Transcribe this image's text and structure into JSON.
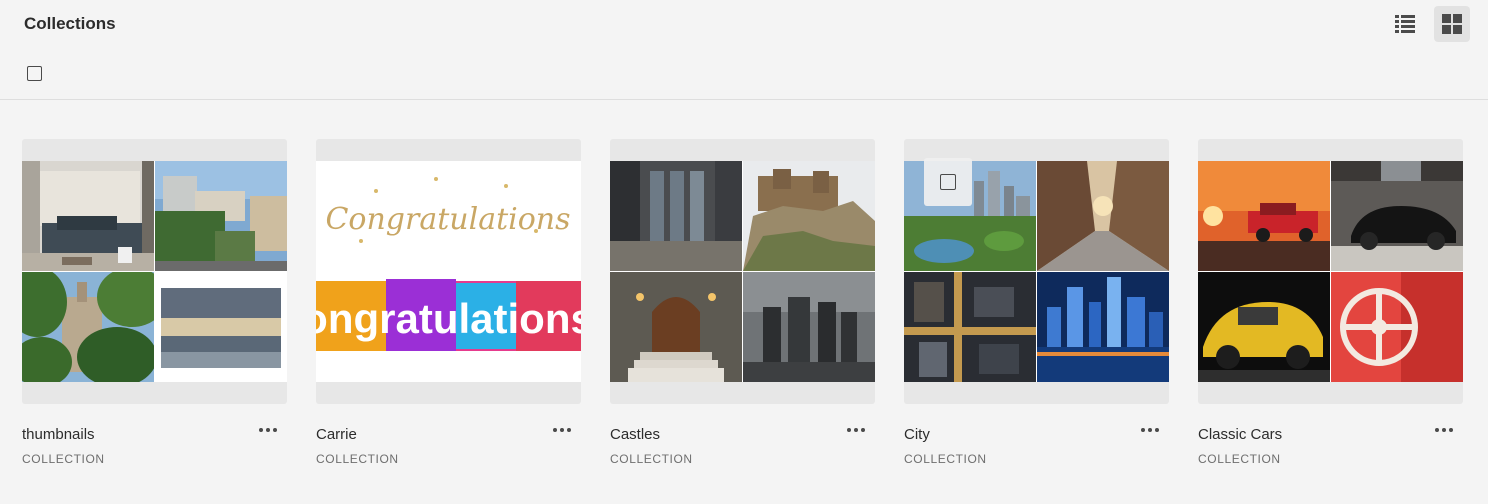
{
  "header": {
    "title": "Collections",
    "list_view_icon": "list-view-icon",
    "grid_view_icon": "grid-view-icon",
    "active_view": "grid"
  },
  "collections": [
    {
      "name": "thumbnails",
      "type": "COLLECTION"
    },
    {
      "name": "Carrie",
      "type": "COLLECTION"
    },
    {
      "name": "Castles",
      "type": "COLLECTION"
    },
    {
      "name": "City",
      "type": "COLLECTION"
    },
    {
      "name": "Classic Cars",
      "type": "COLLECTION"
    }
  ],
  "colors": {
    "background": "#f4f4f4",
    "card_frame": "#e7e7e7",
    "text_primary": "#2c2c2c",
    "text_secondary": "#6e6e6e",
    "active_view_bg": "#e2e2e2"
  }
}
